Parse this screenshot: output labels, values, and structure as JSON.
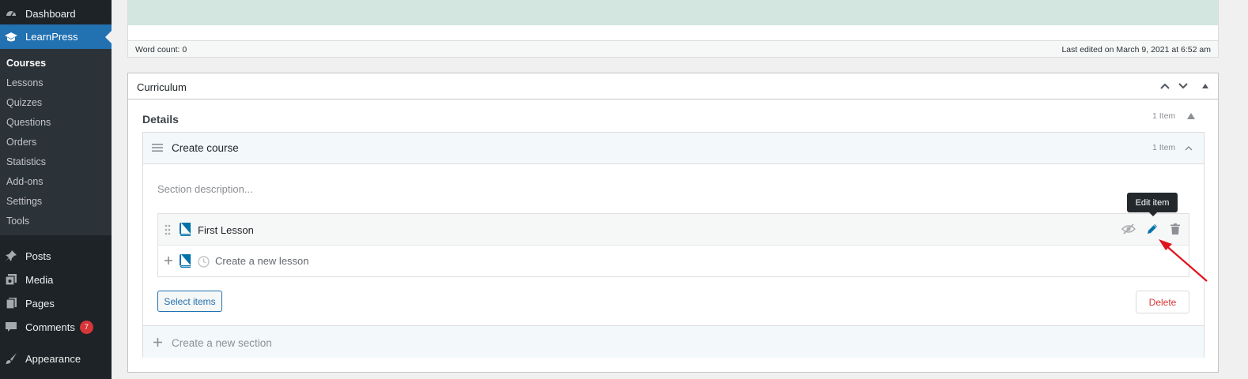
{
  "sidebar": {
    "top_items": [
      {
        "label": "Dashboard",
        "icon": "dashboard-icon"
      },
      {
        "label": "LearnPress",
        "icon": "graduation-cap-icon"
      }
    ],
    "submenu": [
      "Courses",
      "Lessons",
      "Quizzes",
      "Questions",
      "Orders",
      "Statistics",
      "Add-ons",
      "Settings",
      "Tools"
    ],
    "bottom_items": [
      {
        "label": "Posts",
        "icon": "pin-icon"
      },
      {
        "label": "Media",
        "icon": "media-icon"
      },
      {
        "label": "Pages",
        "icon": "pages-icon"
      },
      {
        "label": "Comments",
        "icon": "comment-icon",
        "badge": "7"
      },
      {
        "label": "Appearance",
        "icon": "paintbrush-icon"
      }
    ]
  },
  "editor": {
    "word_count": "Word count: 0",
    "last_edited": "Last edited on March 9, 2021 at 6:52 am"
  },
  "curriculum": {
    "title": "Curriculum",
    "details_title": "Details",
    "details_count": "1 Item",
    "section": {
      "title": "Create course",
      "count": "1 Item",
      "description_placeholder": "Section description...",
      "items": [
        {
          "title": "First Lesson"
        }
      ],
      "new_item_placeholder": "Create a new lesson",
      "select_items_label": "Select items",
      "delete_label": "Delete"
    },
    "new_section_placeholder": "Create a new section",
    "tooltip": "Edit item"
  },
  "colors": {
    "sidebar_bg": "#1d2327",
    "accent": "#2271b1",
    "badge": "#d63638",
    "lesson_icon": "#0073aa",
    "arrow": "#e0141e"
  }
}
